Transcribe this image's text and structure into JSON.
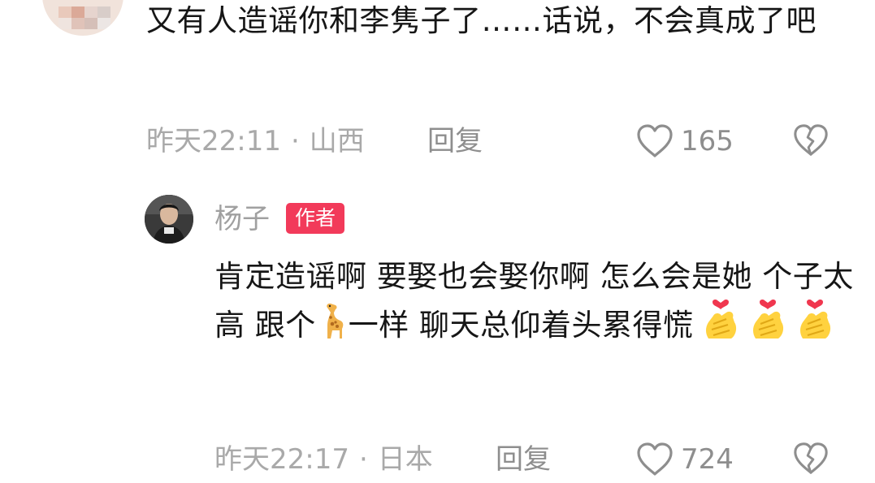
{
  "comment1": {
    "text": "又有人造谣你和李隽子了……话说，不会真成了吧",
    "time": "昨天22:11",
    "separator": "·",
    "location": "山西",
    "reply_label": "回复",
    "like_count": "165"
  },
  "reply": {
    "author_name": "杨子",
    "author_badge": "作者",
    "text_part1": "肯定造谣啊 要娶也会娶你啊 怎么会是她 个子太高 跟个",
    "text_part2": "一样 聊天总仰着头累得慌",
    "emoji_giraffe": "giraffe-emoji",
    "emoji_heart_hands": [
      "heart-hands-emoji",
      "heart-hands-emoji",
      "heart-hands-emoji"
    ],
    "time": "昨天22:17",
    "separator": "·",
    "location": "日本",
    "reply_label": "回复",
    "like_count": "724"
  },
  "colors": {
    "badge": "#f23a5a",
    "meta_text": "#a9a9a9",
    "body_text": "#161616"
  }
}
